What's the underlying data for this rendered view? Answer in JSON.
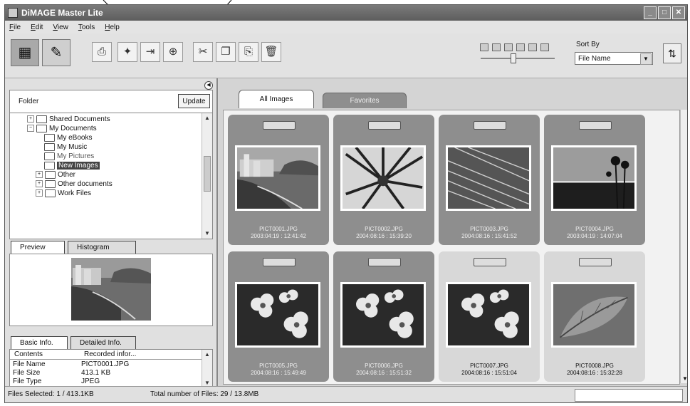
{
  "window": {
    "title": "DiMAGE Master Lite",
    "controls": [
      "minimize-icon",
      "maximize-icon",
      "close-icon"
    ]
  },
  "menu": [
    "File",
    "Edit",
    "View",
    "Tools",
    "Help"
  ],
  "toolbar": {
    "view_buttons": [
      "thumbnail-view-icon",
      "edit-view-icon"
    ],
    "tool_icons": [
      "print-icon",
      "new-folder-icon",
      "move-icon",
      "copy-to-folder-icon",
      "cut-icon",
      "copy-icon",
      "paste-icon",
      "delete-icon"
    ],
    "size_icons": 6,
    "sort_label": "Sort By",
    "sort_value": "File Name",
    "sort_order_icon": "sort-order-icon"
  },
  "folder_panel": {
    "label": "Folder",
    "update_button": "Update",
    "tree": [
      {
        "label": "Shared Documents",
        "expander": "+"
      },
      {
        "label": "My Documents",
        "expander": "−"
      },
      {
        "label": "My eBooks",
        "expander": ""
      },
      {
        "label": "My Music",
        "expander": ""
      },
      {
        "label": "My Pictures",
        "expander": ""
      },
      {
        "label": "New Images",
        "expander": "",
        "selected": true
      },
      {
        "label": "Other",
        "expander": "+"
      },
      {
        "label": "Other documents",
        "expander": "+"
      },
      {
        "label": "Work Files",
        "expander": "+"
      }
    ]
  },
  "preview_tabs": [
    "Preview",
    "Histogram"
  ],
  "info_tabs": [
    "Basic Info.",
    "Detailed Info."
  ],
  "info": {
    "headers": [
      "Contents",
      "Recorded infor..."
    ],
    "rows": [
      {
        "key": "File Name",
        "value": "PICT0001.JPG"
      },
      {
        "key": "File Size",
        "value": "413.1 KB"
      },
      {
        "key": "File Type",
        "value": "JPEG"
      }
    ]
  },
  "gallery_tabs": [
    "All Images",
    "Favorites"
  ],
  "images": [
    {
      "name": "PICT0001.JPG",
      "date": "2003:04:19 : 12:41:42",
      "selected": true,
      "kind": "coast"
    },
    {
      "name": "PICT0002.JPG",
      "date": "2004:08:16 : 15:39:20",
      "selected": true,
      "kind": "palm"
    },
    {
      "name": "PICT0003.JPG",
      "date": "2004:08:16 : 15:41:52",
      "selected": true,
      "kind": "frond"
    },
    {
      "name": "PICT0004.JPG",
      "date": "2003:04:19 : 14:07:04",
      "selected": true,
      "kind": "sunset"
    },
    {
      "name": "PICT0005.JPG",
      "date": "2004:08:16 : 15:49:49",
      "selected": true,
      "kind": "flowers"
    },
    {
      "name": "PICT0006.JPG",
      "date": "2004:08:16 : 15:51:32",
      "selected": true,
      "kind": "flowers"
    },
    {
      "name": "PICT0007.JPG",
      "date": "2004:08:16 : 15:51:04",
      "selected": false,
      "kind": "flowers"
    },
    {
      "name": "PICT0008.JPG",
      "date": "2004:08:16 : 15:32:28",
      "selected": false,
      "kind": "leaf"
    }
  ],
  "status": {
    "selected": "Files Selected: 1 / 413.1KB",
    "total": "Total number of Files: 29 / 13.8MB"
  }
}
